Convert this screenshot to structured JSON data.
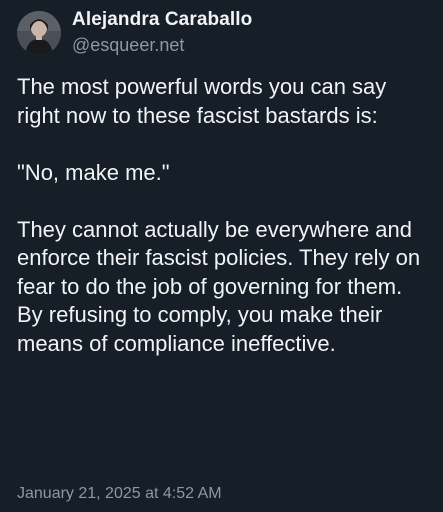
{
  "author": {
    "display_name": "Alejandra Caraballo",
    "handle": "@esqueer.net",
    "avatar_icon": "profile-photo"
  },
  "post": {
    "paragraphs": [
      "The most powerful words you can say right now to these fascist bastards is:",
      "\"No, make me.\"",
      "They cannot actually be everywhere and enforce their fascist policies. They rely on fear to do the job of governing for them. By refusing to comply, you make their means of compliance ineffective."
    ],
    "timestamp": "January 21, 2025 at 4:52 AM"
  },
  "colors": {
    "background": "#161e27",
    "text_primary": "#f1f3f5",
    "text_secondary": "#8b98a8"
  }
}
